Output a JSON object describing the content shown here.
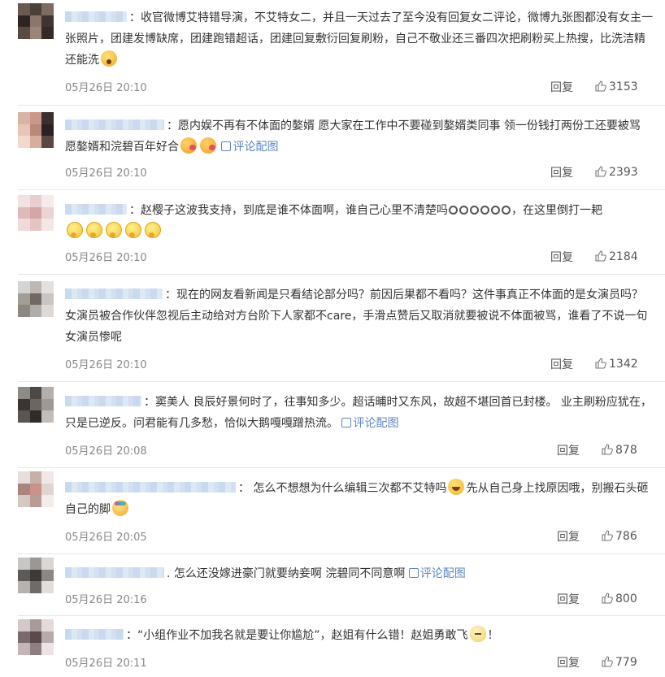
{
  "labels": {
    "reply": "回复"
  },
  "comments": [
    {
      "text_a": "收官微博艾特错导演，不艾特女二，并且一天过去了至今没有回复女二评论，微博九张图都没有女主一张照片，团建发博缺席，团建跑错超话，团建回复敷衍回复刷粉，自己不敬业还三番四次把刷粉买上热搜，比洗洁精还能洗",
      "time": "05月26日 20:10",
      "likes": "3153",
      "emoji_a": "shocked-face"
    },
    {
      "text_a": "愿内娱不再有不体面的嫯婿 愿大家在工作中不要碰到嫯婿类同事 领一份钱打两份工还要被骂 愿嫯婿和浣碧百年好合",
      "link": "评论配图",
      "time": "05月26日 20:10",
      "likes": "2393",
      "emoji_a": "kiss-face"
    },
    {
      "text_a": "赵樱子这波我支持，到底是谁不体面啊，谁自己心里不清楚吗",
      "text_b": "，在这里倒打一耙",
      "time": "05月26日 20:10",
      "likes": "2184",
      "emoji_a": "flower",
      "emoji_b": "thinking-face"
    },
    {
      "text_a": "现在的网友看新闻是只看结论部分吗？前因后果都不看吗？这件事真正不体面的是女演员吗？女演员被合作伙伴忽视后主动给对方台阶下人家都不care，手滑点赞后又取消就要被说不体面被骂，谁看了不说一句女演员惨呢",
      "time": "05月26日 20:10",
      "likes": "1342"
    },
    {
      "text_a": "窦美人 良辰好景何时了，往事知多少。超话晡时又东风，故超不堪回首已封楼。 业主刷粉应犹在，只是已逆反。问君能有几多愁，恰似大鹅嘎嘎蹭热流。",
      "link": "评论配图",
      "time": "05月26日 20:08",
      "likes": "878"
    },
    {
      "text_a": "怎么不想想为什么编辑三次都不艾特吗",
      "text_b": "先从自己身上找原因哦，别搬石头砸自己的脚",
      "time": "05月26日 20:05",
      "likes": "786",
      "emoji_a": "laughing-face",
      "emoji_b": "cheering-face"
    },
    {
      "text_a": "怎么还没嫁进豪门就要纳妾啊 浣碧同不同意啊",
      "link": "评论配图",
      "time": "05月26日 20:16",
      "likes": "800"
    },
    {
      "text_a": "“小组作业不加我名就是要让你尴尬”，赵姐有什么错！赵姐勇敢飞",
      "text_b": "！",
      "time": "05月26日 20:11",
      "likes": "779",
      "emoji_a": "cat-face"
    }
  ]
}
